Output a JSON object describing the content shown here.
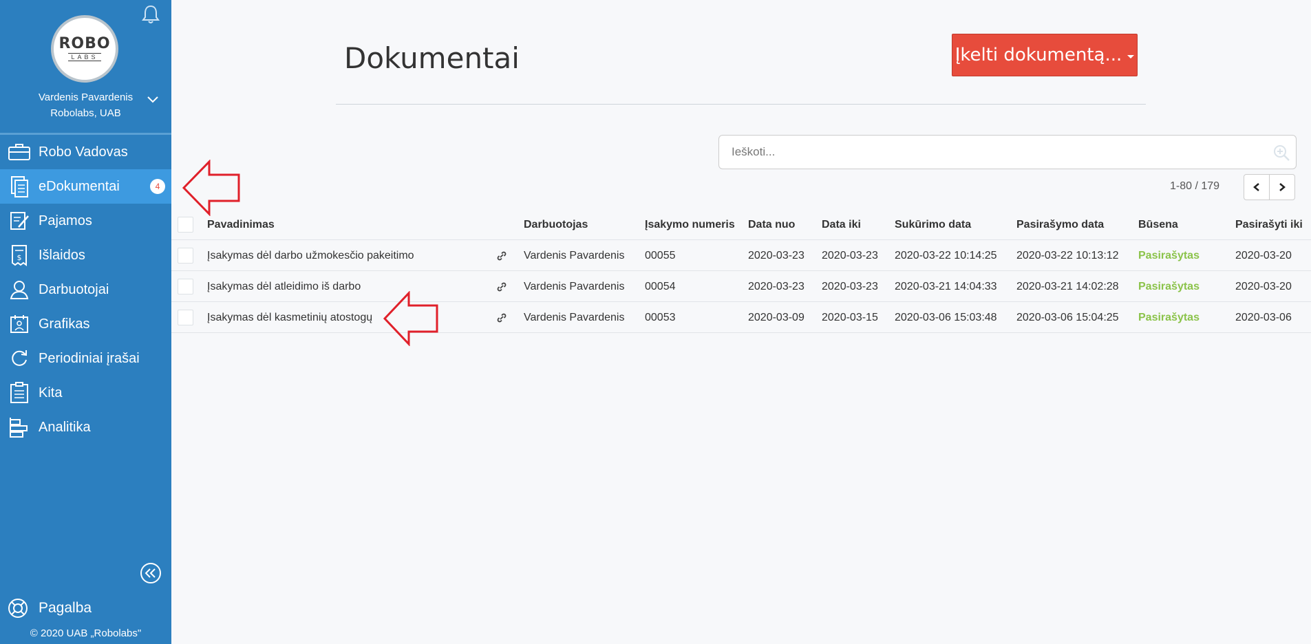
{
  "app": {
    "logo_top": "ROBO",
    "logo_bottom": "LABS",
    "user_name": "Vardenis Pavardenis",
    "company": "Robolabs, UAB",
    "copyright": "© 2020 UAB „Robolabs\""
  },
  "sidebar": {
    "items": [
      {
        "label": "Robo Vadovas",
        "icon": "briefcase-icon"
      },
      {
        "label": "eDokumentai",
        "icon": "documents-icon",
        "badge": "4",
        "active": true
      },
      {
        "label": "Pajamos",
        "icon": "invoice-edit-icon"
      },
      {
        "label": "Išlaidos",
        "icon": "receipt-icon"
      },
      {
        "label": "Darbuotojai",
        "icon": "person-icon"
      },
      {
        "label": "Grafikas",
        "icon": "calendar-person-icon"
      },
      {
        "label": "Periodiniai įrašai",
        "icon": "refresh-icon"
      },
      {
        "label": "Kita",
        "icon": "clipboard-icon"
      },
      {
        "label": "Analitika",
        "icon": "bar-analytics-icon"
      }
    ],
    "help_label": "Pagalba"
  },
  "main": {
    "title": "Dokumentai",
    "upload_button": "Įkelti dokumentą...",
    "search_placeholder": "Ieškoti...",
    "pager": "1-80 / 179"
  },
  "table": {
    "columns": [
      "Pavadinimas",
      "Darbuotojas",
      "Įsakymo numeris",
      "Data nuo",
      "Data iki",
      "Sukūrimo data",
      "Pasirašymo data",
      "Būsena",
      "Pasirašyti iki"
    ],
    "rows": [
      {
        "name": "Įsakymas dėl darbo užmokesčio pakeitimo",
        "employee": "Vardenis Pavardenis",
        "number": "00055",
        "date_from": "2020-03-23",
        "date_to": "2020-03-23",
        "created": "2020-03-22 10:14:25",
        "signed": "2020-03-22 10:13:12",
        "status": "Pasirašytas",
        "sign_until": "2020-03-20"
      },
      {
        "name": "Įsakymas dėl atleidimo iš darbo",
        "employee": "Vardenis Pavardenis",
        "number": "00054",
        "date_from": "2020-03-23",
        "date_to": "2020-03-23",
        "created": "2020-03-21 14:04:33",
        "signed": "2020-03-21 14:02:28",
        "status": "Pasirašytas",
        "sign_until": "2020-03-20"
      },
      {
        "name": "Įsakymas dėl kasmetinių atostogų",
        "employee": "Vardenis Pavardenis",
        "number": "00053",
        "date_from": "2020-03-09",
        "date_to": "2020-03-15",
        "created": "2020-03-06 15:03:48",
        "signed": "2020-03-06 15:04:25",
        "status": "Pasirašytas",
        "sign_until": "2020-03-06"
      }
    ]
  },
  "colors": {
    "sidebar": "#2c7fbf",
    "sidebar_active": "#3d9ae0",
    "upload_button": "#e74c3c",
    "status_signed": "#8bc34a",
    "annotation_arrow": "#e0202a"
  }
}
